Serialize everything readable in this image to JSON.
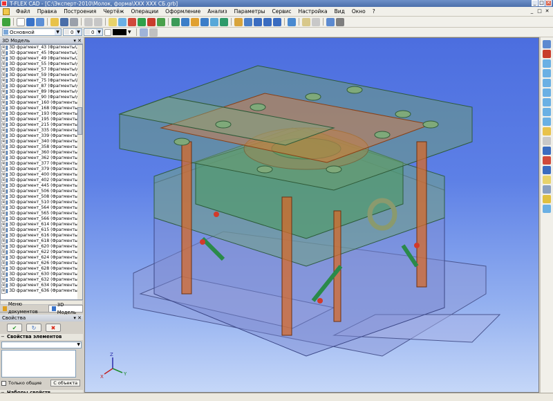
{
  "window": {
    "title": "T-FLEX CAD - [C:\\Эксперт-2010\\Молок, форма\\ХХХ ХХХ СБ.grb]",
    "controls": [
      "_",
      "□",
      "✕"
    ]
  },
  "menu": {
    "items": [
      "Файл",
      "Правка",
      "Построения",
      "Чертёж",
      "Операции",
      "Оформление",
      "Анализ",
      "Параметры",
      "Сервис",
      "Настройка",
      "Вид",
      "Окно",
      "?"
    ],
    "mdi_controls": [
      "_",
      "□",
      "✕"
    ]
  },
  "toolbar2": {
    "layer_combo": "Основной",
    "level_combo": "0",
    "width_combo": "0"
  },
  "panel_model": {
    "title": "3D Модель",
    "controls": "▾ ✕",
    "items": [
      "3D фрагмент_43 (Фрагменты\\Знак",
      "3D фрагмент_45 (Фрагменты\\Знак",
      "3D фрагмент_49 (Фрагменты\\Знак",
      "3D фрагмент_55 (Фрагменты\\Фро",
      "3D фрагмент_57 (Фрагменты\\Фро",
      "3D фрагмент_59 (Фрагменты\\Фро",
      "3D фрагмент_75 (Фрагменты\\Кры",
      "3D фрагмент_87 (Фрагменты\\Фро",
      "3D фрагмент_89 (Фрагменты\\Фро",
      "3D фрагмент_90 (Фрагменты\\Фро",
      "3D фрагмент_160 (Фрагменты\\Фр",
      "3D фрагмент_168 (Фрагменты\\Фр",
      "3D фрагмент_193 (Фрагменты\\Фр",
      "3D фрагмент_195 (Фрагменты\\Фр",
      "3D фрагмент_215 (Фрагменты\\Фр",
      "3D фрагмент_335 (Фрагменты\\Фр",
      "3D фрагмент_339 (Фрагменты\\Фр",
      "3D фрагмент_340 (Фрагменты\\Фр",
      "3D фрагмент_358 (Фрагменты\\Фр",
      "3D фрагмент_360 (Фрагменты\\Фр",
      "3D фрагмент_362 (Фрагменты\\Фр",
      "3D фрагмент_377 (Фрагменты\\Фр",
      "3D фрагмент_379 (Фрагменты\\Фр",
      "3D фрагмент_400 (Фрагменты\\Фр",
      "3D фрагмент_402 (Фрагменты\\Фр",
      "3D фрагмент_445 (Фрагменты\\Фр",
      "3D фрагмент_506 (Фрагменты\\Фр",
      "3D фрагмент_508 (Фрагменты\\Фр",
      "3D фрагмент_510 (Фрагменты\\Фр",
      "3D фрагмент_564 (Фрагменты\\Фр",
      "3D фрагмент_565 (Фрагменты\\Фр",
      "3D фрагмент_566 (Фрагменты\\Фр",
      "3D фрагмент_614 (Фрагменты\\Фр",
      "3D фрагмент_615 (Фрагменты\\Фр",
      "3D фрагмент_616 (Фрагменты\\Фр",
      "3D фрагмент_618 (Фрагменты\\Фр",
      "3D фрагмент_620 (Фрагменты\\Фр",
      "3D фрагмент_622 (Фрагменты\\Фр",
      "3D фрагмент_624 (Фрагменты\\Фр",
      "3D фрагмент_626 (Фрагменты\\Фр",
      "3D фрагмент_628 (Фрагменты\\Фр",
      "3D фрагмент_630 (Фрагменты\\Фр",
      "3D фрагмент_632 (Фрагменты\\Фр",
      "3D фрагмент_634 (Фрагменты\\Фр",
      "3D фрагмент_636 (Фрагменты\\Фр"
    ],
    "tabs": [
      "Меню документов",
      "3D Модель"
    ]
  },
  "panel_props": {
    "title": "Свойства",
    "controls": "▾ ✕",
    "section_elements": "Свойства элементов",
    "checkbox_label": "Только общие",
    "from_object_button": "С объекта",
    "section_sets": "Наборы свойств"
  },
  "axes": {
    "x": "X",
    "y": "Y",
    "z": "Z"
  },
  "colors": {
    "viewport_top": "#4c6edf",
    "viewport_bottom": "#c5d7f8",
    "part_green": "#6f9b5b",
    "part_orange": "#e0742e",
    "part_blue": "#7f8fcf"
  }
}
